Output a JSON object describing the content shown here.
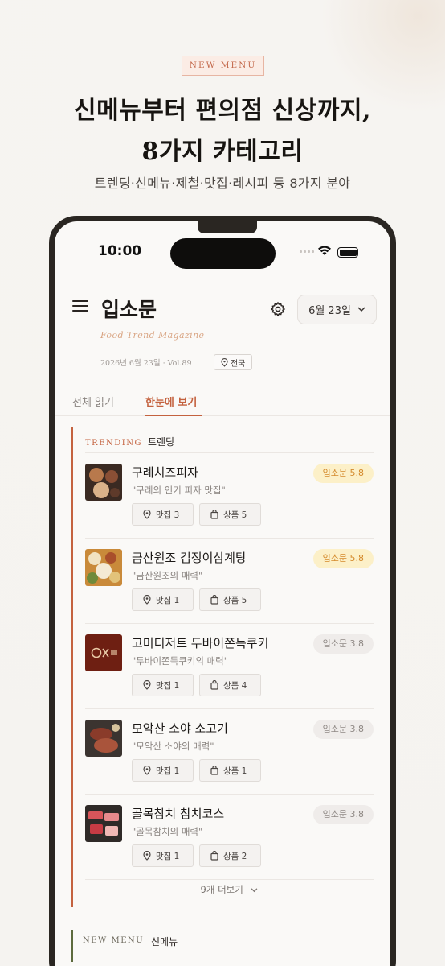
{
  "promo": {
    "badge": "NEW MENU",
    "title_line1": "신메뉴부터 편의점 신상까지,",
    "title_line2": "8가지 카테고리",
    "subtitle": "트렌딩·신메뉴·제철·맛집·레시피 등 8가지 분야"
  },
  "status_bar": {
    "time": "10:00"
  },
  "header": {
    "title": "입소문",
    "tagline": "Food Trend Magazine",
    "date_button": "6월 23일",
    "issue": "2026년 6월 23일  ·  Vol.89",
    "region": "전국"
  },
  "tabs": [
    {
      "label": "전체 읽기",
      "active": false
    },
    {
      "label": "한눈에 보기",
      "active": true
    }
  ],
  "trending": {
    "label_en": "TRENDING",
    "label_ko": "트렌딩",
    "more_label": "9개 더보기",
    "items": [
      {
        "name": "구례치즈피자",
        "quote": "\"구례의 인기 피자 맛집\"",
        "score": "입소문 5.8",
        "hot": true,
        "restaurants": "맛집 3",
        "products": "상품 5"
      },
      {
        "name": "금산원조 김정이삼계탕",
        "quote": "\"금산원조의 매력\"",
        "score": "입소문 5.8",
        "hot": true,
        "restaurants": "맛집 1",
        "products": "상품 5"
      },
      {
        "name": "고미디저트 두바이쫀득쿠키",
        "quote": "\"두바이쫀득쿠키의 매력\"",
        "score": "입소문 3.8",
        "hot": false,
        "restaurants": "맛집 1",
        "products": "상품 4"
      },
      {
        "name": "모악산 소야 소고기",
        "quote": "\"모악산 소야의 매력\"",
        "score": "입소문 3.8",
        "hot": false,
        "restaurants": "맛집 1",
        "products": "상품 1"
      },
      {
        "name": "골목참치 참치코스",
        "quote": "\"골목참치의 매력\"",
        "score": "입소문 3.8",
        "hot": false,
        "restaurants": "맛집 1",
        "products": "상품 2"
      }
    ]
  },
  "new_menu": {
    "label_en": "NEW MENU",
    "label_ko": "신메뉴"
  },
  "colors": {
    "accent": "#c4623f",
    "hot_score_bg": "#fcf0c8",
    "hot_score_text": "#d48a2c",
    "new_menu_bar": "#5d6b3d"
  }
}
